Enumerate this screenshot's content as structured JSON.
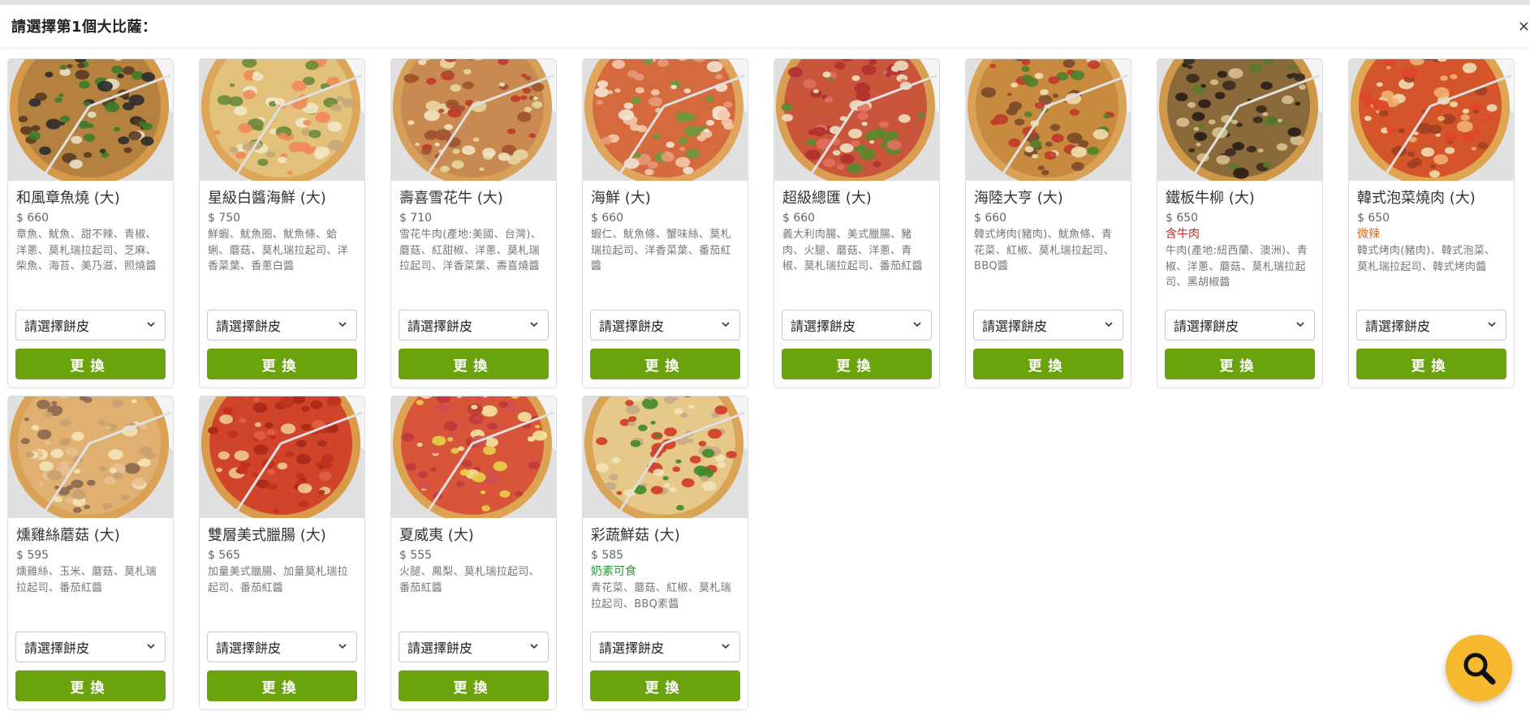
{
  "header": {
    "title": "請選擇第1個大比薩：",
    "close_glyph": "×"
  },
  "common": {
    "crust_placeholder": "請選擇餅皮",
    "swap_label": "更換"
  },
  "colors": {
    "swap_button": "#6aa30d",
    "search_fab": "#f5b82e",
    "spicy_tag": "#e0661a",
    "beef_tag": "#c9221a",
    "veg_tag": "#2a9a3a"
  },
  "pizzas": [
    {
      "name": "和風章魚燒 (大)",
      "price": "$ 660",
      "tag": "",
      "ingredients": "章魚、魷魚、甜不辣、青椒、洋蔥、莫札瑞拉起司、芝麻、柴魚、海苔、美乃滋、照燒醬",
      "image_icon": "pizza-japanese-takoyaki"
    },
    {
      "name": "星級白醬海鮮 (大)",
      "price": "$ 750",
      "tag": "",
      "ingredients": "鮮蝦、魷魚圈、魷魚條、蛤蜊、蘑菇、莫札瑞拉起司、洋香菜葉、香蔥白醬",
      "image_icon": "pizza-white-sauce-seafood"
    },
    {
      "name": "壽喜雪花牛 (大)",
      "price": "$ 710",
      "tag": "",
      "ingredients": "雪花牛肉(產地:美國、台灣)、蘑菇、紅甜椒、洋蔥、莫札瑞拉起司、洋香菜葉、壽喜燒醬",
      "image_icon": "pizza-sukiyaki-beef"
    },
    {
      "name": "海鮮 (大)",
      "price": "$ 660",
      "tag": "",
      "ingredients": "蝦仁、魷魚條、蟹味絲、莫札瑞拉起司、洋香菜葉、番茄紅醬",
      "image_icon": "pizza-seafood"
    },
    {
      "name": "超級總匯 (大)",
      "price": "$ 660",
      "tag": "",
      "ingredients": "義大利肉腸、美式臘腸、豬肉、火腿、蘑菇、洋蔥、青椒、莫札瑞拉起司、番茄紅醬",
      "image_icon": "pizza-super-supreme"
    },
    {
      "name": "海陸大亨 (大)",
      "price": "$ 660",
      "tag": "",
      "ingredients": "韓式烤肉(豬肉)、魷魚條、青花菜、紅椒、莫札瑞拉起司、BBQ醬",
      "image_icon": "pizza-surf-and-turf"
    },
    {
      "name": "鐵板牛柳 (大)",
      "price": "$ 650",
      "tag": "含牛肉",
      "tag_style": "red",
      "ingredients": "牛肉(產地:紐西蘭、澳洲)、青椒、洋蔥、蘑菇、莫札瑞拉起司、黑胡椒醬",
      "image_icon": "pizza-teppan-beef"
    },
    {
      "name": "韓式泡菜燒肉 (大)",
      "price": "$ 650",
      "tag": "微辣",
      "tag_style": "orange",
      "ingredients": "韓式烤肉(豬肉)、韓式泡菜、莫札瑞拉起司、韓式烤肉醬",
      "image_icon": "pizza-kimchi-bbq"
    },
    {
      "name": "燻雞絲蘑菇 (大)",
      "price": "$ 595",
      "tag": "",
      "ingredients": "燻雞絲、玉米、蘑菇、莫札瑞拉起司、番茄紅醬",
      "image_icon": "pizza-smoked-chicken-mushroom"
    },
    {
      "name": "雙層美式臘腸 (大)",
      "price": "$ 565",
      "tag": "",
      "ingredients": "加量美式臘腸、加量莫札瑞拉起司、番茄紅醬",
      "image_icon": "pizza-double-pepperoni"
    },
    {
      "name": "夏威夷 (大)",
      "price": "$ 555",
      "tag": "",
      "ingredients": "火腿、鳳梨、莫札瑞拉起司、番茄紅醬",
      "image_icon": "pizza-hawaiian"
    },
    {
      "name": "彩蔬鮮菇 (大)",
      "price": "$ 585",
      "tag": "奶素可食",
      "tag_style": "green",
      "ingredients": "青花菜、蘑菇、紅椒、莫札瑞拉起司、BBQ素醬",
      "image_icon": "pizza-veggie-mushroom"
    }
  ],
  "search_fab": {
    "icon": "magnifier-icon"
  }
}
